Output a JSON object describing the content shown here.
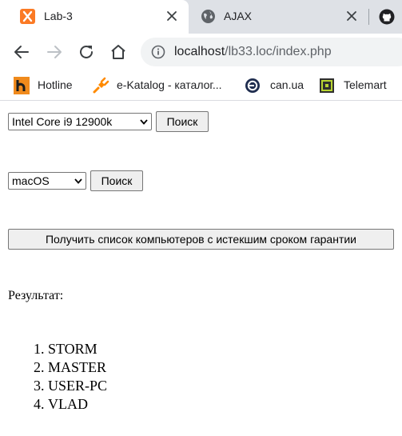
{
  "tabs": [
    {
      "title": "Lab-3",
      "active": true,
      "icon": "xampp-icon"
    },
    {
      "title": "AJAX",
      "active": false,
      "icon": "globe-icon"
    }
  ],
  "toolbar": {
    "url_host": "localhost",
    "url_path": "/lb33.loc/index.php"
  },
  "bookmarks": [
    {
      "label": "Hotline",
      "icon": "hotline-icon"
    },
    {
      "label": "e-Katalog - каталог...",
      "icon": "plug-icon"
    },
    {
      "label": "can.ua",
      "icon": "can-ua-icon"
    },
    {
      "label": "Telemart",
      "icon": "telemart-icon"
    }
  ],
  "form": {
    "cpu_select_value": "Intel Core i9 12900k",
    "cpu_search_label": "Поиск",
    "os_select_value": "macOS",
    "os_search_label": "Поиск",
    "warranty_button_label": "Получить список компьютеров с истекшим сроком гарантии"
  },
  "result": {
    "label": "Результат:",
    "items": [
      "STORM",
      "MASTER",
      "USER-PC",
      "VLAD"
    ]
  },
  "colors": {
    "tabbar_bg": "#dee1e6",
    "omnibox_bg": "#f1f3f4",
    "xampp_orange": "#fb7a24"
  }
}
